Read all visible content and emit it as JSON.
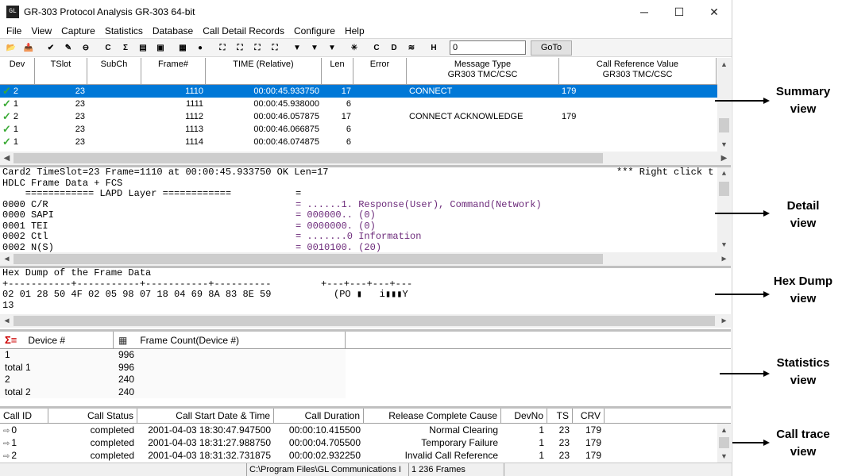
{
  "window": {
    "title": "GR-303 Protocol Analysis GR-303 64-bit",
    "icon_label": "GL",
    "min_glyph": "─",
    "max_glyph": "☐",
    "close_glyph": "✕"
  },
  "menu": [
    "File",
    "View",
    "Capture",
    "Statistics",
    "Database",
    "Call Detail Records",
    "Configure",
    "Help"
  ],
  "toolbar": {
    "buttons": [
      {
        "name": "open-file-icon",
        "glyph": "📂"
      },
      {
        "name": "open-capture-icon",
        "glyph": "📥"
      },
      {
        "name": "filter-icon",
        "glyph": "✔"
      },
      {
        "name": "edit-icon",
        "glyph": "✎"
      },
      {
        "name": "stop-icon",
        "glyph": "⊖"
      },
      {
        "name": "call-icon",
        "glyph": "C"
      },
      {
        "name": "statistics-icon",
        "glyph": "Σ"
      },
      {
        "name": "database-icon",
        "glyph": "▤"
      },
      {
        "name": "save-icon",
        "glyph": "▣"
      },
      {
        "name": "grid-icon",
        "glyph": "▦"
      },
      {
        "name": "circle-icon",
        "glyph": "●"
      },
      {
        "name": "search-binoculars-icon",
        "glyph": "⛶"
      },
      {
        "name": "search-next-icon",
        "glyph": "⛶"
      },
      {
        "name": "search-prev-icon",
        "glyph": "⛶"
      },
      {
        "name": "search-all-icon",
        "glyph": "⛶"
      },
      {
        "name": "set-filter-icon",
        "glyph": "▼"
      },
      {
        "name": "set-trigger-icon",
        "glyph": "▼"
      },
      {
        "name": "trigger-icon",
        "glyph": "▼"
      },
      {
        "name": "decode-icon",
        "glyph": "✳"
      },
      {
        "name": "config-c-icon",
        "glyph": "C"
      },
      {
        "name": "config-d-icon",
        "glyph": "D"
      },
      {
        "name": "pdu-icon",
        "glyph": "≋"
      },
      {
        "name": "hex-view-icon",
        "glyph": "H"
      }
    ],
    "goto_value": "0",
    "goto_label": "GoTo"
  },
  "summary": {
    "headers": [
      {
        "line1": "Dev",
        "line2": ""
      },
      {
        "line1": "TSlot",
        "line2": ""
      },
      {
        "line1": "SubCh",
        "line2": ""
      },
      {
        "line1": "Frame#",
        "line2": ""
      },
      {
        "line1": "TIME (Relative)",
        "line2": ""
      },
      {
        "line1": "Len",
        "line2": ""
      },
      {
        "line1": "Error",
        "line2": ""
      },
      {
        "line1": "Message Type",
        "line2": "GR303 TMC/CSC"
      },
      {
        "line1": "Call Reference Value",
        "line2": "GR303 TMC/CSC"
      }
    ],
    "rows": [
      {
        "dev": "2",
        "tslot": "23",
        "subch": "",
        "frame": "1110",
        "time": "00:00:45.933750",
        "len": "17",
        "error": "",
        "msg": "CONNECT",
        "crv": "179",
        "selected": true
      },
      {
        "dev": "1",
        "tslot": "23",
        "subch": "",
        "frame": "1111",
        "time": "00:00:45.938000",
        "len": "6",
        "error": "",
        "msg": "",
        "crv": "",
        "selected": false
      },
      {
        "dev": "2",
        "tslot": "23",
        "subch": "",
        "frame": "1112",
        "time": "00:00:46.057875",
        "len": "17",
        "error": "",
        "msg": "CONNECT ACKNOWLEDGE",
        "crv": "179",
        "selected": false
      },
      {
        "dev": "1",
        "tslot": "23",
        "subch": "",
        "frame": "1113",
        "time": "00:00:46.066875",
        "len": "6",
        "error": "",
        "msg": "",
        "crv": "",
        "selected": false
      },
      {
        "dev": "1",
        "tslot": "23",
        "subch": "",
        "frame": "1114",
        "time": "00:00:46.074875",
        "len": "6",
        "error": "",
        "msg": "",
        "crv": "",
        "selected": false
      }
    ]
  },
  "detail": {
    "line0_left": "Card2 TimeSlot=23 Frame=1110 at 00:00:45.933750 OK Len=17",
    "line0_right": "*** Right click t",
    "line1": "HDLC Frame Data + FCS",
    "line2_left": "    ============ LAPD Layer ============",
    "line2_right": "=",
    "fields": [
      {
        "left": "0000 C/R",
        "right": "= ......1. Response(User), Command(Network)"
      },
      {
        "left": "0000 SAPI",
        "right": "= 000000.. (0)"
      },
      {
        "left": "0001 TEI",
        "right": "= 0000000. (0)"
      },
      {
        "left": "0002 Ctl",
        "right": "= .......0 Information"
      },
      {
        "left": "0002 N(S)",
        "right": "= 0010100. (20)"
      }
    ]
  },
  "hexdump": {
    "title": "Hex Dump of the Frame Data",
    "rule_left": "+-----------+-----------+-----------+----------",
    "rule_right": "+---+---+---+---",
    "hex_line": "02 01 28 50 4F 02 05 98 07 18 04 69 8A 83 8E 59",
    "ascii_line": "(PO ▮   i▮▮▮Y",
    "hex_line2": "13"
  },
  "statistics": {
    "header_device": "Device #",
    "header_count": "Frame Count(Device #)",
    "rows": [
      {
        "device": "1",
        "count": "996"
      },
      {
        "device": "total 1",
        "count": "996"
      },
      {
        "device": "2",
        "count": "240"
      },
      {
        "device": "total 2",
        "count": "240"
      }
    ]
  },
  "calltrace": {
    "headers": [
      "Call ID",
      "Call Status",
      "Call Start Date & Time",
      "Call Duration",
      "Release Complete Cause",
      "DevNo",
      "TS",
      "CRV"
    ],
    "rows": [
      {
        "id": "0",
        "status": "completed",
        "start": "2001-04-03 18:30:47.947500",
        "duration": "00:00:10.415500",
        "cause": "Normal Clearing",
        "devno": "1",
        "ts": "23",
        "crv": "179"
      },
      {
        "id": "1",
        "status": "completed",
        "start": "2001-04-03 18:31:27.988750",
        "duration": "00:00:04.705500",
        "cause": "Temporary Failure",
        "devno": "1",
        "ts": "23",
        "crv": "179"
      },
      {
        "id": "2",
        "status": "completed",
        "start": "2001-04-03 18:31:32.731875",
        "duration": "00:00:02.932250",
        "cause": "Invalid Call Reference",
        "devno": "1",
        "ts": "23",
        "crv": "179"
      }
    ]
  },
  "statusbar": {
    "path": "C:\\Program Files\\GL Communications I",
    "frames": "1 236 Frames"
  },
  "annotations": [
    {
      "text": "Summary\nview"
    },
    {
      "text": "Detail\nview"
    },
    {
      "text": "Hex Dump\nview"
    },
    {
      "text": "Statistics\nview"
    },
    {
      "text": "Call trace\nview"
    }
  ]
}
